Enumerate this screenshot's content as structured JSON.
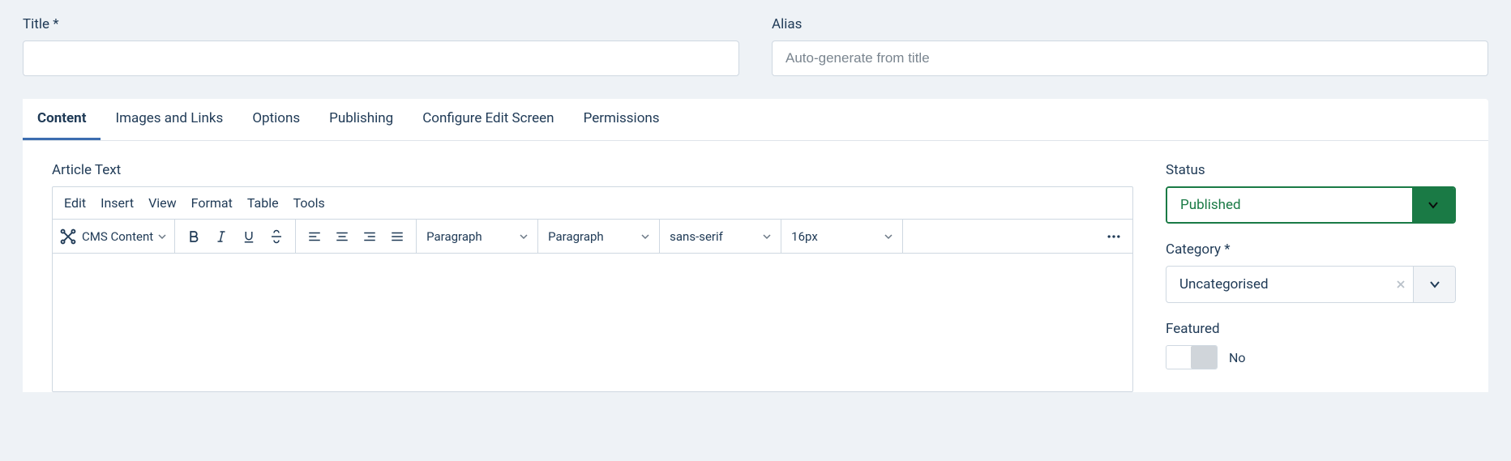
{
  "fields": {
    "title_label": "Title *",
    "title_value": "",
    "alias_label": "Alias",
    "alias_value": "",
    "alias_placeholder": "Auto-generate from title"
  },
  "tabs": {
    "content": "Content",
    "images": "Images and Links",
    "options": "Options",
    "publishing": "Publishing",
    "configure": "Configure Edit Screen",
    "permissions": "Permissions"
  },
  "editor": {
    "label": "Article Text",
    "menu": {
      "edit": "Edit",
      "insert": "Insert",
      "view": "View",
      "format": "Format",
      "table": "Table",
      "tools": "Tools"
    },
    "cms_label": "CMS Content",
    "block1": "Paragraph",
    "block2": "Paragraph",
    "font_family": "sans-serif",
    "font_size": "16px"
  },
  "sidebar": {
    "status_label": "Status",
    "status_value": "Published",
    "category_label": "Category *",
    "category_value": "Uncategorised",
    "featured_label": "Featured",
    "featured_value": "No"
  }
}
